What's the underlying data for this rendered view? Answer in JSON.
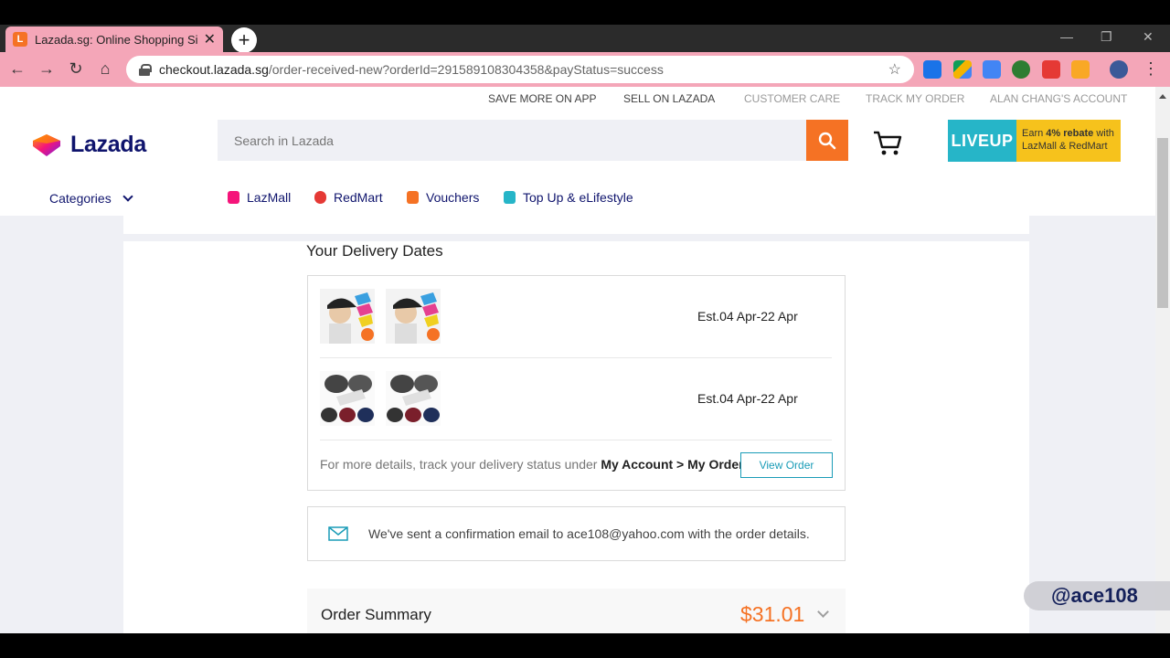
{
  "browser": {
    "tab_title": "Lazada.sg: Online Shopping Sing",
    "url_host": "checkout.lazada.sg",
    "url_path": "/order-received-new?orderId=291589108304358&payStatus=success"
  },
  "topbar": {
    "save_more": "SAVE MORE ON APP",
    "sell": "SELL ON LAZADA",
    "customer_care": "CUSTOMER CARE",
    "track_order": "TRACK MY ORDER",
    "account": "ALAN CHANG'S ACCOUNT"
  },
  "header": {
    "logo_text": "Lazada",
    "search_placeholder": "Search in Lazada",
    "liveup_label": "LIVEUP",
    "liveup_promo_prefix": "Earn ",
    "liveup_promo_bold": "4% rebate",
    "liveup_promo_suffix": " with LazMall & RedMart"
  },
  "nav": {
    "categories": "Categories",
    "links": [
      "LazMall",
      "RedMart",
      "Vouchers",
      "Top Up & eLifestyle"
    ]
  },
  "delivery": {
    "title": "Your Delivery Dates",
    "items": [
      {
        "est": "Est.04 Apr-22 Apr"
      },
      {
        "est": "Est.04 Apr-22 Apr"
      }
    ],
    "details_prefix": "For more details, track your delivery status under ",
    "details_bold": "My Account > My Order",
    "view_order": "View Order"
  },
  "email_notice": "We've sent a confirmation email to ace108@yahoo.com with the order details.",
  "summary": {
    "title": "Order Summary",
    "amount": "$31.01"
  },
  "watermark": "@ace108",
  "colors": {
    "accent": "#f57224",
    "brand_navy": "#0f146d",
    "link_teal": "#1a9cb7",
    "tab_pink": "#f4a6b8"
  }
}
